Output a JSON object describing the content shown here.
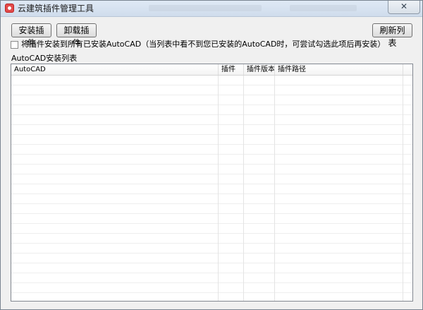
{
  "window": {
    "title": "云建筑插件管理工具",
    "close_glyph": "✕"
  },
  "toolbar": {
    "install_label": "安装插件",
    "uninstall_label": "卸载插件",
    "refresh_label": "刷新列表"
  },
  "options": {
    "install_all_checked": false,
    "install_all_label": "将插件安装到所有已安装AutoCAD（当列表中看不到您已安装的AutoCAD时，可尝试勾选此项后再安装）"
  },
  "list": {
    "group_label": "AutoCAD安装列表",
    "columns": [
      "AutoCAD",
      "插件",
      "插件版本",
      "插件路径"
    ],
    "rows": []
  }
}
